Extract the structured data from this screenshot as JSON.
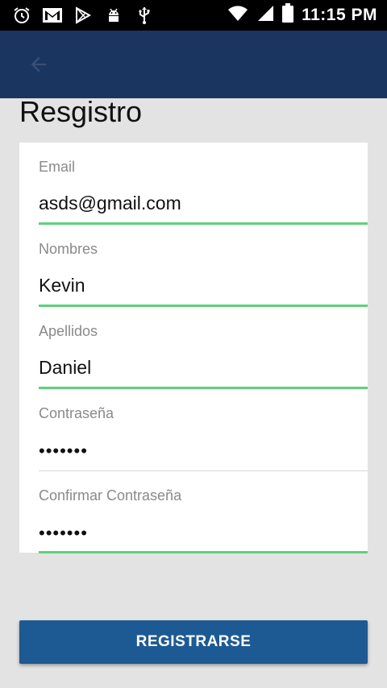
{
  "status_bar": {
    "time": "11:15 PM",
    "icons": [
      "alarm-icon",
      "gmail-icon",
      "play-store-icon",
      "android-icon",
      "usb-icon",
      "wifi-icon",
      "signal-icon",
      "battery-icon"
    ]
  },
  "app_bar": {
    "back_icon": "arrow-back-icon"
  },
  "page": {
    "title": "Resgistro"
  },
  "form": {
    "email": {
      "label": "Email",
      "value": "asds@gmail.com"
    },
    "nombres": {
      "label": "Nombres",
      "value": "Kevin"
    },
    "apellidos": {
      "label": "Apellidos",
      "value": "Daniel"
    },
    "password": {
      "label": "Contraseña",
      "value": "•••••••"
    },
    "confirm_password": {
      "label": "Confirmar Contraseña",
      "value": "•••••••"
    }
  },
  "actions": {
    "register_label": "REGISTRARSE"
  },
  "colors": {
    "app_bar": "#1b3561",
    "button": "#1d5a93",
    "focus_line": "#5fd07a",
    "background": "#e3e3e3"
  }
}
